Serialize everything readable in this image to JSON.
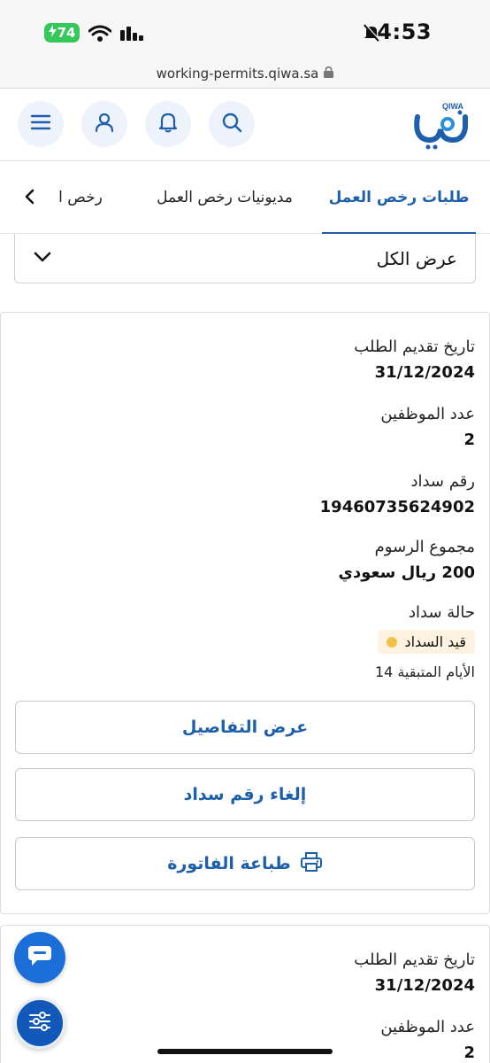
{
  "status_bar": {
    "time": "4:53",
    "battery": "74",
    "url": "working-permits.qiwa.sa",
    "icons": [
      "charging-icon",
      "wifi-icon",
      "signal-icon",
      "bell-mute-icon",
      "lock-icon"
    ]
  },
  "header": {
    "logo_text": "QIWA",
    "buttons": [
      "menu-icon",
      "user-icon",
      "bell-icon",
      "search-icon"
    ]
  },
  "tabs": [
    {
      "label": "طلبات رخص العمل",
      "active": true
    },
    {
      "label": "مديونيات رخص العمل",
      "active": false
    },
    {
      "label": "رخص ا",
      "active": false
    }
  ],
  "filter": {
    "value": "عرض الكل"
  },
  "cards": [
    {
      "submission_date_label": "تاريخ تقديم الطلب",
      "submission_date": "31/12/2024",
      "employees_label": "عدد الموظفين",
      "employees": "2",
      "sadad_label": "رقم سداد",
      "sadad_number": "19460735624902",
      "fees_label": "مجموع الرسوم",
      "fees_total": "200 ريال سعودي",
      "status_label": "حالة سداد",
      "status": "قيد السداد",
      "remaining_days": "الأيام المتبقية 14",
      "view_details": "عرض التفاصيل",
      "cancel_sadad": "إلغاء رقم سداد",
      "print_invoice": "طباعة الفاتورة"
    },
    {
      "submission_date_label": "تاريخ تقديم الطلب",
      "submission_date": "31/12/2024",
      "employees_label": "عدد الموظفين",
      "employees": "2"
    }
  ],
  "colors": {
    "primary": "#1d5fad",
    "fab": "#1c6fd9",
    "battery": "#34c759",
    "status_badge_bg": "#fdf3e0",
    "status_dot": "#f1c24a"
  }
}
